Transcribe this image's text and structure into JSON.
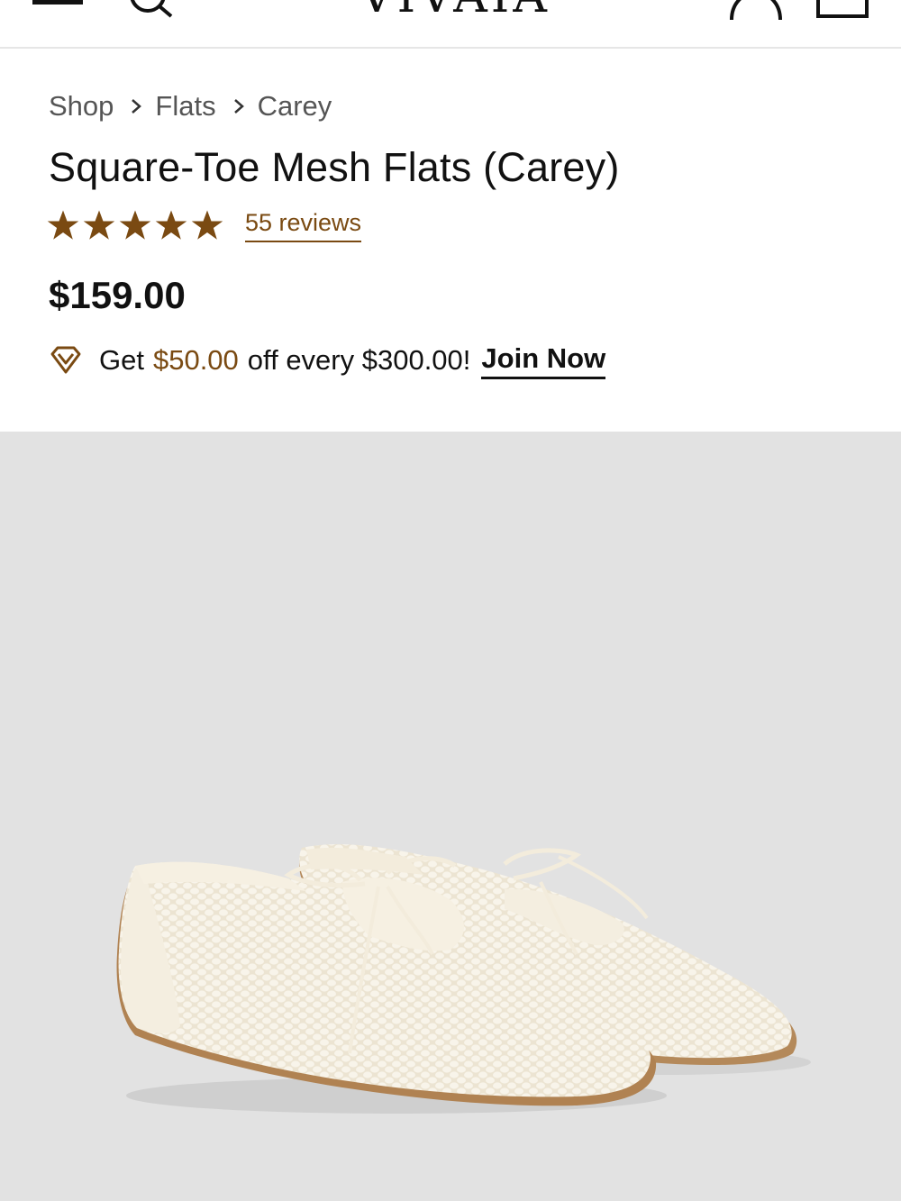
{
  "header": {
    "brand": "VIVAIA",
    "icons": [
      "menu-icon",
      "search-icon",
      "account-icon",
      "cart-icon"
    ]
  },
  "breadcrumb": {
    "items": [
      {
        "label": "Shop"
      },
      {
        "label": "Flats"
      },
      {
        "label": "Carey"
      }
    ]
  },
  "product": {
    "title": "Square-Toe Mesh Flats (Carey)",
    "rating": 5,
    "rating_max": 5,
    "reviews_label": "55 reviews",
    "price": "$159.00"
  },
  "promo": {
    "prefix": "Get",
    "amount": "$50.00",
    "suffix": "off every $300.00!",
    "cta": "Join Now"
  },
  "colors": {
    "accent": "#7a4a12",
    "star": "#7a4a12",
    "image_bg": "#e2e2e2"
  }
}
